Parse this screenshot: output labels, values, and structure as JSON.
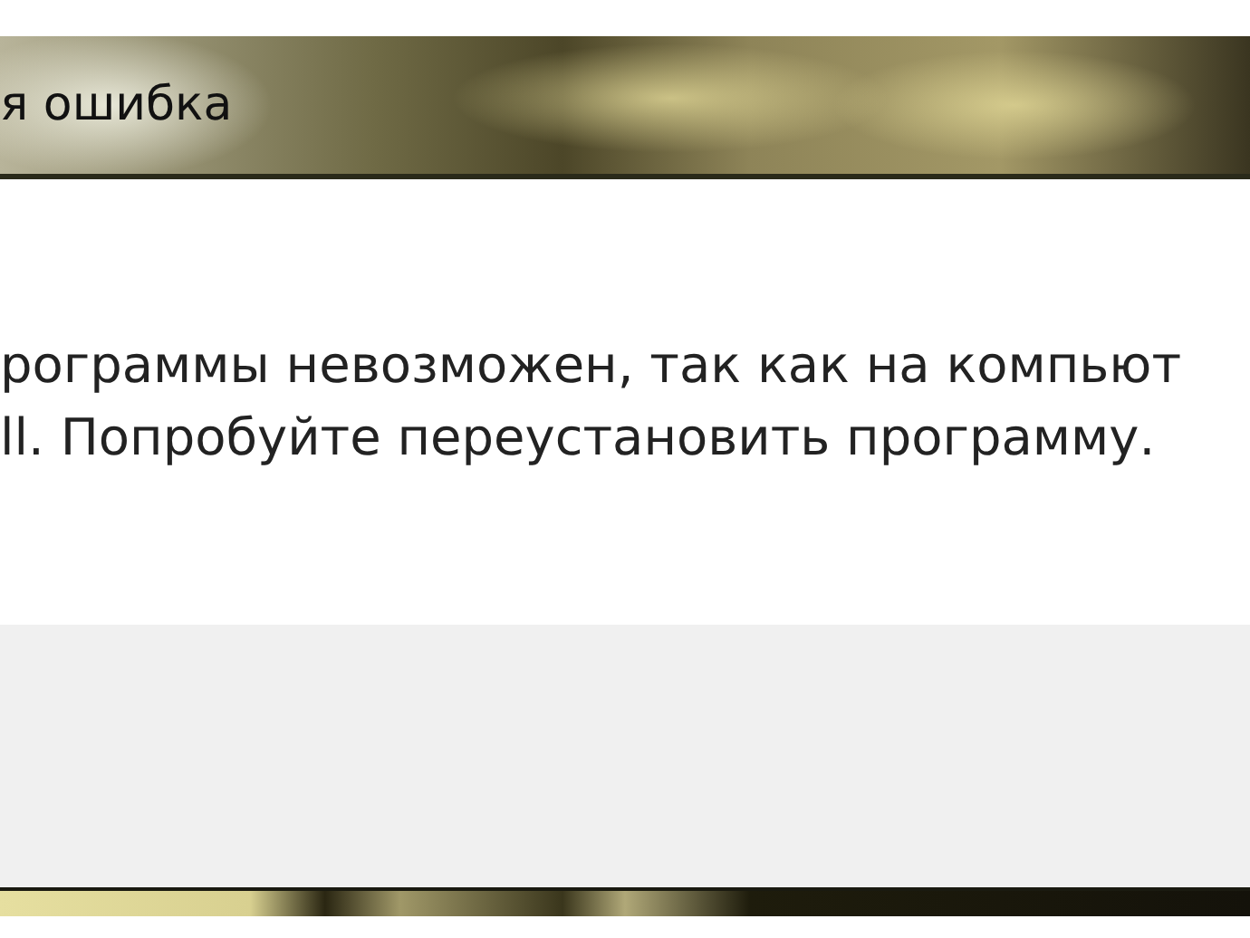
{
  "window": {
    "title": "я ошибка"
  },
  "message": {
    "lines": [
      "рограммы невозможен, так как на компьют",
      "ll. Попробуйте переустановить программу."
    ]
  }
}
